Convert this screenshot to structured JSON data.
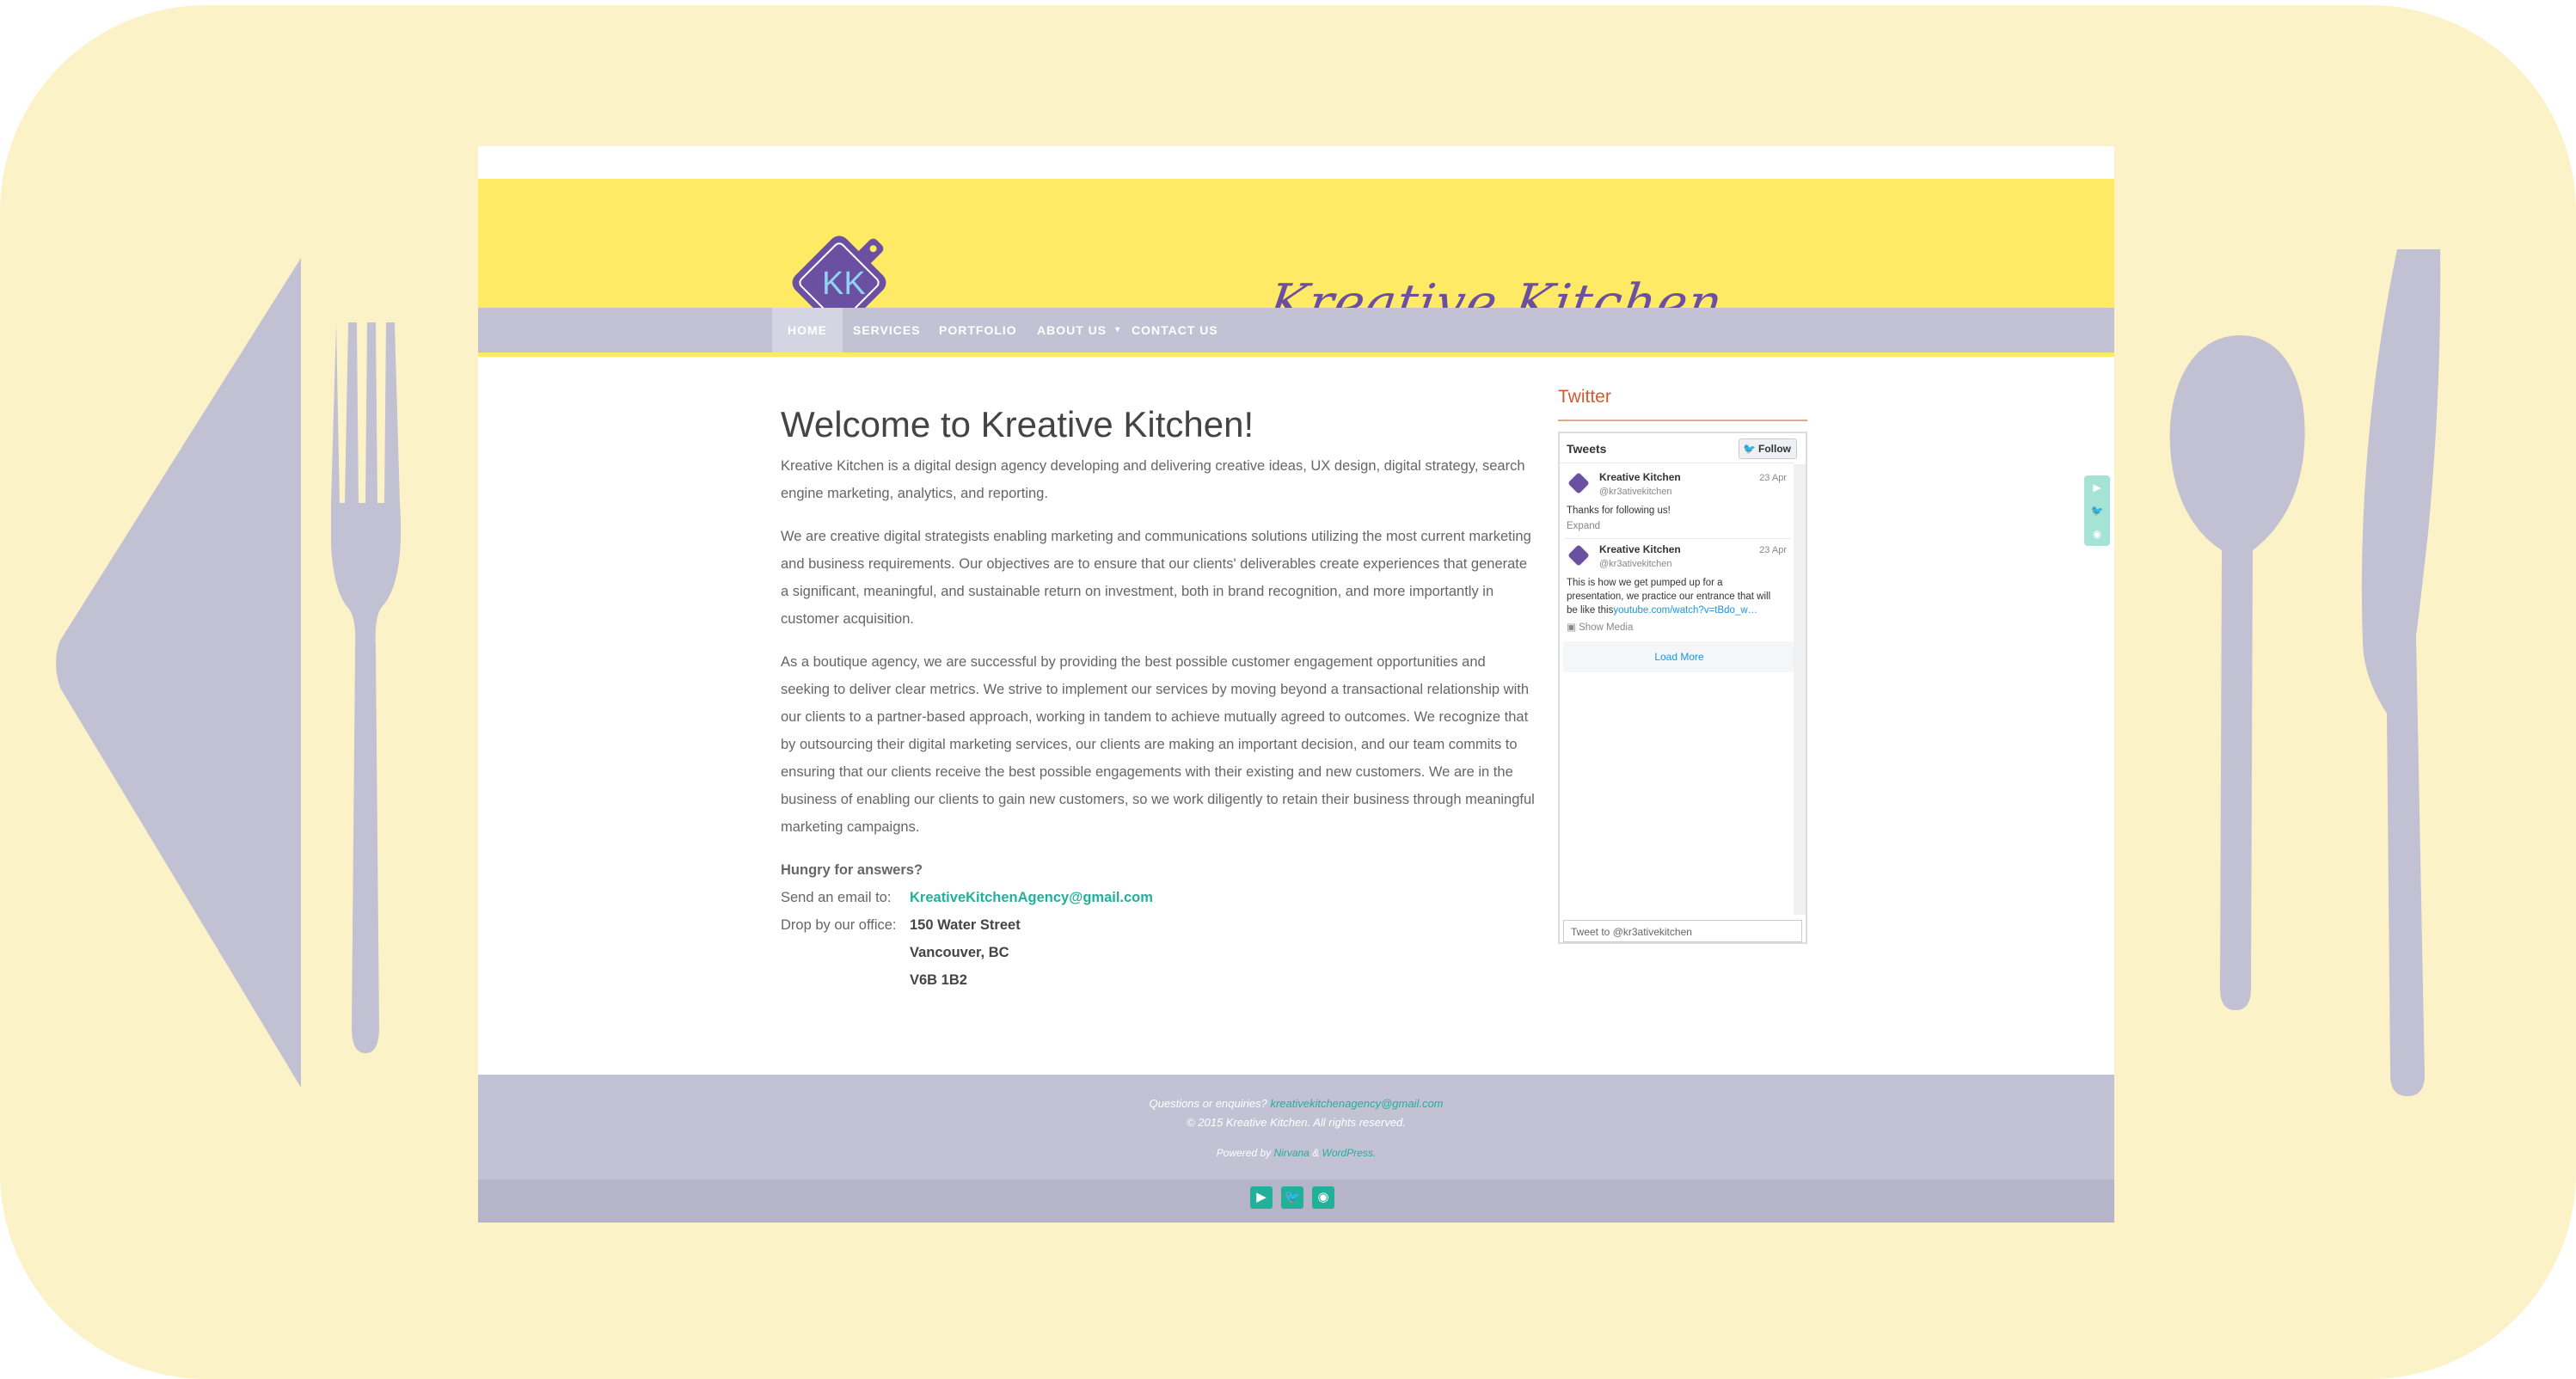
{
  "site": {
    "title": "Kreative Kitchen",
    "logo_letters": "KK"
  },
  "nav": {
    "items": [
      {
        "label": "HOME"
      },
      {
        "label": "SERVICES"
      },
      {
        "label": "PORTFOLIO"
      },
      {
        "label": "ABOUT US"
      },
      {
        "label": "CONTACT US"
      }
    ]
  },
  "main": {
    "heading": "Welcome to Kreative Kitchen!",
    "paragraphs": [
      "Kreative Kitchen is a digital design agency developing and delivering creative ideas, UX design, digital strategy, search engine marketing, analytics, and reporting.",
      "We are creative digital strategists enabling marketing and communications solutions utilizing the most current marketing and business requirements. Our objectives are to ensure that our clients' deliverables create experiences that generate a significant, meaningful, and sustainable return on investment, both in brand recognition, and more importantly in customer acquisition.",
      "As a boutique agency, we are successful by providing the best possible customer engagement opportunities and seeking to deliver clear metrics. We strive to implement our services by moving beyond a transactional relationship with our clients to a partner-based approach, working in tandem to achieve mutually agreed to outcomes. We recognize that by outsourcing their digital marketing services, our clients are making an important decision, and our team commits to ensuring that our clients receive the best possible engagements with their existing and new customers. We are in the business of enabling our clients to gain new customers, so we work diligently to retain their business through meaningful marketing campaigns."
    ],
    "contact_heading": "Hungry for answers?",
    "email_label": "Send an email to:",
    "email": "KreativeKitchenAgency@gmail.com",
    "office_label": "Drop by our office:",
    "address": [
      "150 Water Street",
      "Vancouver, BC",
      "V6B 1B2"
    ]
  },
  "sidebar": {
    "title": "Twitter",
    "widget": {
      "header": "Tweets",
      "follow_label": "Follow",
      "tweets": [
        {
          "name": "Kreative Kitchen",
          "handle": "@kr3ativekitchen",
          "date": "23 Apr",
          "text": "Thanks for following us!",
          "action": "Expand"
        },
        {
          "name": "Kreative Kitchen",
          "handle": "@kr3ativekitchen",
          "date": "23 Apr",
          "text": "This is how we get pumped up for a presentation, we practice our entrance that will be like this",
          "link": "youtube.com/watch?v=tBdo_w…",
          "action": "Show Media"
        }
      ],
      "load_more": "Load More",
      "compose_placeholder": "Tweet to @kr3ativekitchen"
    }
  },
  "footer": {
    "question_label": "Questions or enquiries?",
    "email": "kreativekitchenagency@gmail.com",
    "copyright": "© 2015 Kreative Kitchen. All rights reserved.",
    "powered_prefix": "Powered by",
    "powered_theme": "Nirvana",
    "powered_amp": "&",
    "powered_platform": "WordPress."
  },
  "icons": {
    "social": [
      "youtube-icon",
      "twitter-icon",
      "rss-icon"
    ]
  },
  "colors": {
    "header_yellow": "#ffea66",
    "nav_lavender": "#c3c2d4",
    "accent_teal": "#22b09b",
    "logo_purple": "#6b4fa0",
    "placemat": "#fcf2c8"
  }
}
